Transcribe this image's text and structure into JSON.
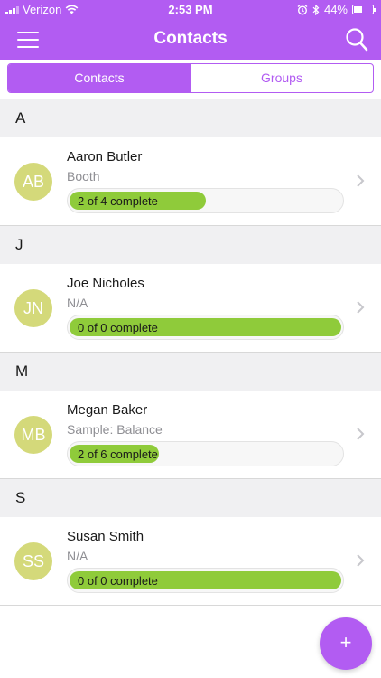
{
  "status_bar": {
    "carrier": "Verizon",
    "time": "2:53 PM",
    "battery": "44%",
    "battery_level": 0.44,
    "signal_bars": 3,
    "icons": [
      "signal-icon",
      "wifi-icon",
      "alarm-icon",
      "bluetooth-icon",
      "battery-icon"
    ]
  },
  "navbar": {
    "title": "Contacts",
    "menu_icon": "hamburger-menu-icon",
    "search_icon": "search-icon"
  },
  "tabs": [
    {
      "label": "Contacts",
      "active": true
    },
    {
      "label": "Groups",
      "active": false
    }
  ],
  "sections": [
    {
      "letter": "A",
      "contacts": [
        {
          "initials": "AB",
          "name": "Aaron Butler",
          "subtitle": "Booth",
          "progress_text": "2 of 4 complete",
          "progress": 0.5
        }
      ]
    },
    {
      "letter": "J",
      "contacts": [
        {
          "initials": "JN",
          "name": "Joe Nicholes",
          "subtitle": "N/A",
          "progress_text": "0 of 0 complete",
          "progress": 1.0
        }
      ]
    },
    {
      "letter": "M",
      "contacts": [
        {
          "initials": "MB",
          "name": "Megan Baker",
          "subtitle": "Sample: Balance",
          "progress_text": "2 of 6 complete",
          "progress": 0.33
        }
      ]
    },
    {
      "letter": "S",
      "contacts": [
        {
          "initials": "SS",
          "name": "Susan Smith",
          "subtitle": "N/A",
          "progress_text": "0 of 0 complete",
          "progress": 1.0
        }
      ]
    }
  ],
  "fab": {
    "label": "+",
    "icon": "add-icon"
  },
  "colors": {
    "accent": "#b25cf2",
    "avatar": "#d4d97a",
    "progress": "#8fcb3a",
    "section_bg": "#f0f0f2"
  }
}
